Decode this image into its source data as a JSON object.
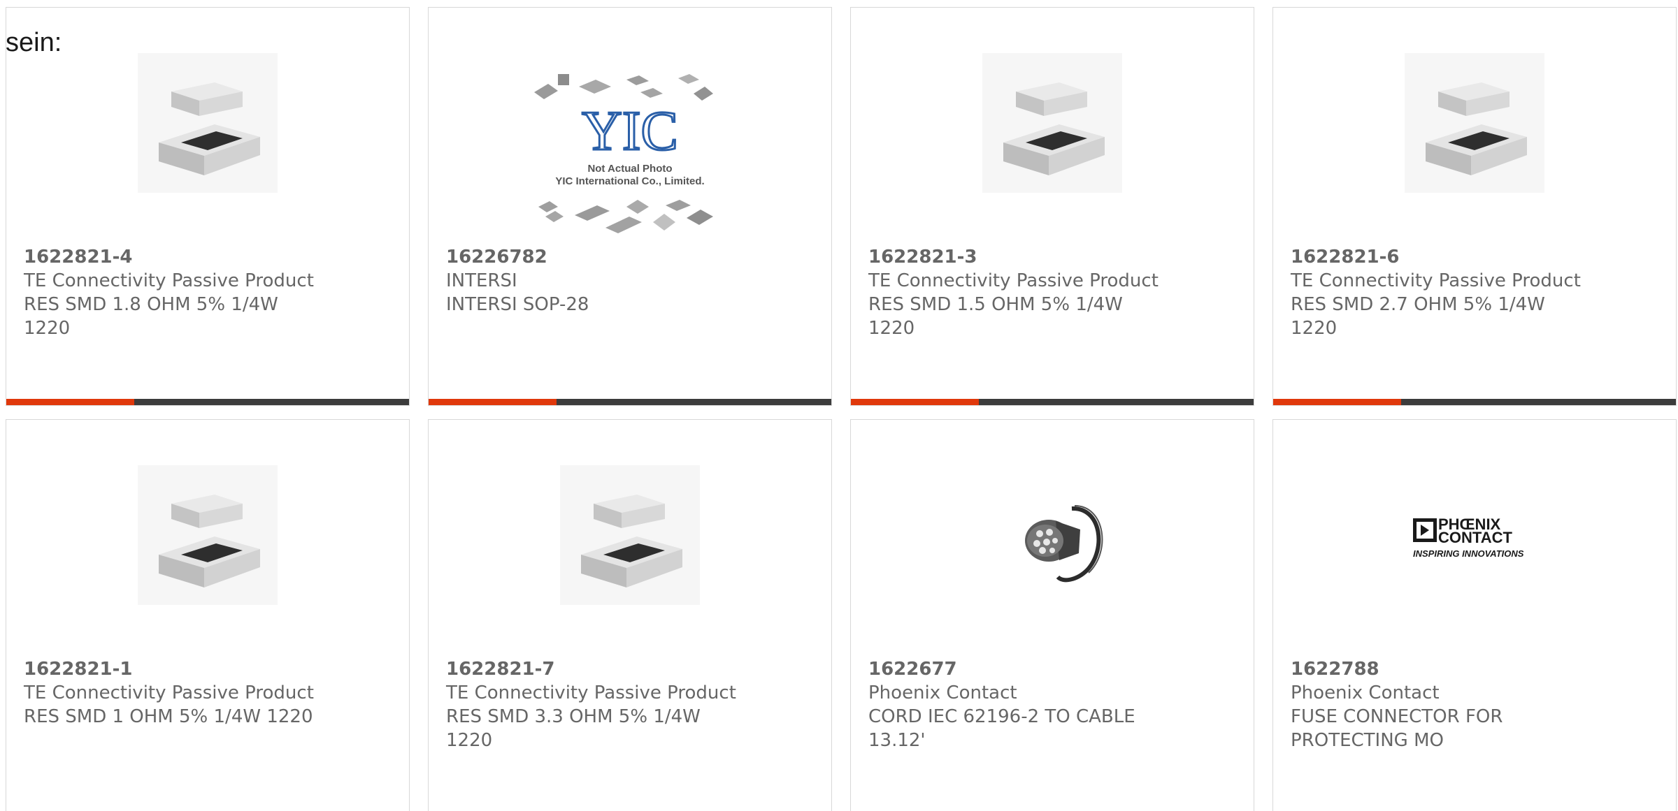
{
  "intro_text": "sein:",
  "accent_color": "#e0380b",
  "bar_color": "#3c3c3c",
  "products": [
    {
      "part_no": "1622821-4",
      "manufacturer": "TE Connectivity Passive Product",
      "description": "RES SMD 1.8 OHM 5% 1/4W 1220",
      "image": "resistor-chip-icon"
    },
    {
      "part_no": "16226782",
      "manufacturer": "INTERSI",
      "description": "INTERSI SOP-28",
      "image": "yic-placeholder-image",
      "image_caption_1": "Not Actual Photo",
      "image_caption_2": "YIC International Co., Limited.",
      "image_logo": "YIC"
    },
    {
      "part_no": "1622821-3",
      "manufacturer": "TE Connectivity Passive Product",
      "description": "RES SMD 1.5 OHM 5% 1/4W 1220",
      "image": "resistor-chip-icon"
    },
    {
      "part_no": "1622821-6",
      "manufacturer": "TE Connectivity Passive Product",
      "description": "RES SMD 2.7 OHM 5% 1/4W 1220",
      "image": "resistor-chip-icon"
    },
    {
      "part_no": "1622821-1",
      "manufacturer": "TE Connectivity Passive Product",
      "description": "RES SMD 1 OHM 5% 1/4W 1220",
      "image": "resistor-chip-icon"
    },
    {
      "part_no": "1622821-7",
      "manufacturer": "TE Connectivity Passive Product",
      "description": "RES SMD 3.3 OHM 5% 1/4W 1220",
      "image": "resistor-chip-icon"
    },
    {
      "part_no": "1622677",
      "manufacturer": "Phoenix Contact",
      "description": "CORD IEC 62196-2 TO CABLE 13.12'",
      "image": "ev-charging-cable-icon"
    },
    {
      "part_no": "1622788",
      "manufacturer": "Phoenix Contact",
      "description": "FUSE CONNECTOR FOR PROTECTING MO",
      "image": "phoenix-contact-logo",
      "logo_line_1": "PHŒNIX",
      "logo_line_2": "CONTACT",
      "logo_tagline": "INSPIRING INNOVATIONS"
    }
  ]
}
